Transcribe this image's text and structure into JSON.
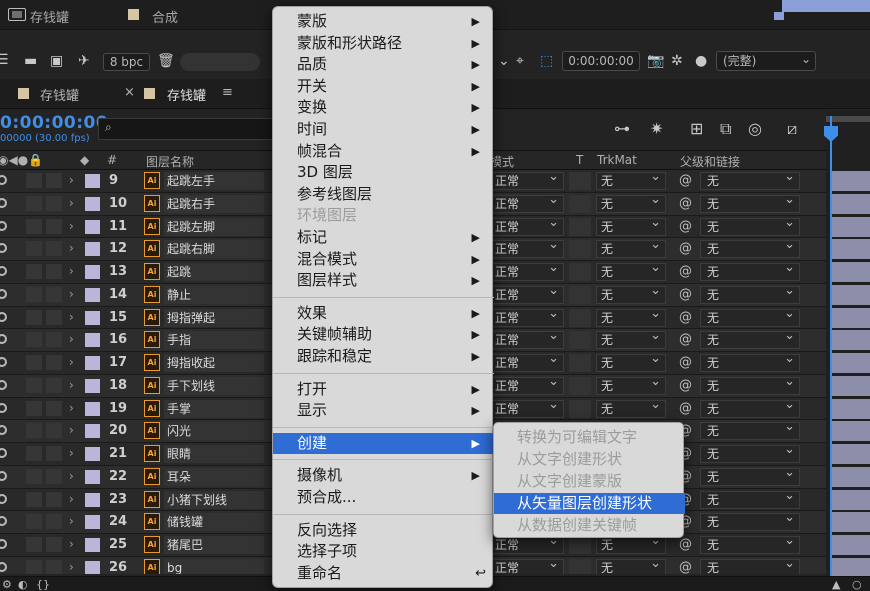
{
  "topbar": {
    "tab1": "存钱罐",
    "tab2": "合成"
  },
  "toolbar": {
    "bpc": "8 bpc",
    "timecode": "0:00:00:00",
    "resolution": "(完整)"
  },
  "tabs": {
    "tab1": "存钱罐",
    "tab2": "存钱罐"
  },
  "timeline": {
    "timecode": "0:00:00:00",
    "fps": "00000 (30.00 fps)"
  },
  "columns": {
    "num": "#",
    "layer_name": "图层名称",
    "mode": "模式",
    "t": "T",
    "trkmat": "TrkMat",
    "parent": "父级和链接"
  },
  "layers": [
    {
      "num": "9",
      "name": "起跳左手",
      "mode": "正常",
      "trkmat": "无",
      "parent": "无"
    },
    {
      "num": "10",
      "name": "起跳右手",
      "mode": "正常",
      "trkmat": "无",
      "parent": "无"
    },
    {
      "num": "11",
      "name": "起跳左脚",
      "mode": "正常",
      "trkmat": "无",
      "parent": "无"
    },
    {
      "num": "12",
      "name": "起跳右脚",
      "mode": "正常",
      "trkmat": "无",
      "parent": "无"
    },
    {
      "num": "13",
      "name": "起跳",
      "mode": "正常",
      "trkmat": "无",
      "parent": "无"
    },
    {
      "num": "14",
      "name": "静止",
      "mode": "正常",
      "trkmat": "无",
      "parent": "无"
    },
    {
      "num": "15",
      "name": "拇指弹起",
      "mode": "正常",
      "trkmat": "无",
      "parent": "无"
    },
    {
      "num": "16",
      "name": "手指",
      "mode": "正常",
      "trkmat": "无",
      "parent": "无"
    },
    {
      "num": "17",
      "name": "拇指收起",
      "mode": "正常",
      "trkmat": "无",
      "parent": "无"
    },
    {
      "num": "18",
      "name": "手下划线",
      "mode": "正常",
      "trkmat": "无",
      "parent": "无"
    },
    {
      "num": "19",
      "name": "手掌",
      "mode": "正常",
      "trkmat": "无",
      "parent": "无"
    },
    {
      "num": "20",
      "name": "闪光",
      "mode": "正常",
      "trkmat": "无",
      "parent": "无"
    },
    {
      "num": "21",
      "name": "眼睛",
      "mode": "正常",
      "trkmat": "无",
      "parent": "无"
    },
    {
      "num": "22",
      "name": "耳朵",
      "mode": "正常",
      "trkmat": "无",
      "parent": "无"
    },
    {
      "num": "23",
      "name": "小猪下划线",
      "mode": "正常",
      "trkmat": "无",
      "parent": "无"
    },
    {
      "num": "24",
      "name": "储钱罐",
      "mode": "正常",
      "trkmat": "无",
      "parent": "无"
    },
    {
      "num": "25",
      "name": "猪尾巴",
      "mode": "正常",
      "trkmat": "无",
      "parent": "无"
    },
    {
      "num": "26",
      "name": "bg",
      "mode": "正常",
      "trkmat": "无",
      "parent": "无"
    }
  ],
  "context_menu": {
    "items": [
      {
        "label": "蒙版",
        "submenu": true
      },
      {
        "label": "蒙版和形状路径",
        "submenu": true
      },
      {
        "label": "品质",
        "submenu": true
      },
      {
        "label": "开关",
        "submenu": true
      },
      {
        "label": "变换",
        "submenu": true
      },
      {
        "label": "时间",
        "submenu": true
      },
      {
        "label": "帧混合",
        "submenu": true
      },
      {
        "label": "3D 图层"
      },
      {
        "label": "参考线图层"
      },
      {
        "label": "环境图层",
        "disabled": true
      },
      {
        "label": "标记",
        "submenu": true
      },
      {
        "label": "混合模式",
        "submenu": true
      },
      {
        "label": "图层样式",
        "submenu": true
      },
      {
        "label": "效果",
        "submenu": true
      },
      {
        "label": "关键帧辅助",
        "submenu": true
      },
      {
        "label": "跟踪和稳定",
        "submenu": true
      },
      {
        "label": "打开",
        "submenu": true
      },
      {
        "label": "显示",
        "submenu": true
      },
      {
        "label": "创建",
        "submenu": true,
        "active": true
      },
      {
        "label": "摄像机",
        "submenu": true
      },
      {
        "label": "预合成..."
      },
      {
        "label": "反向选择"
      },
      {
        "label": "选择子项"
      },
      {
        "label": "重命名",
        "shortcut": "↩"
      }
    ]
  },
  "submenu": {
    "items": [
      {
        "label": "转换为可编辑文字",
        "state": "disabled"
      },
      {
        "label": "从文字创建形状",
        "state": "disabled"
      },
      {
        "label": "从文字创建蒙版",
        "state": "disabled"
      },
      {
        "label": "从矢量图层创建形状",
        "state": "active"
      },
      {
        "label": "从数据创建关键帧",
        "state": "disabled"
      }
    ]
  },
  "colors": {
    "accent": "#2f6cd4",
    "timecode": "#3f8ee8",
    "label": "#b9b6d9",
    "ai_orange": "#e99a2c"
  }
}
